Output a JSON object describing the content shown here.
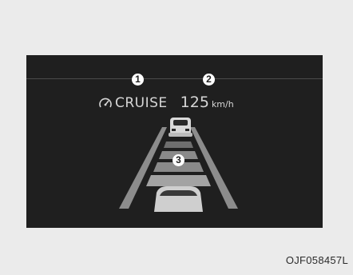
{
  "cluster": {
    "cruise_label": "CRUISE",
    "speed_value": "125",
    "speed_unit": "km/h",
    "icon": "cruise-speedometer-icon"
  },
  "callouts": [
    "1",
    "2",
    "3"
  ],
  "caption": "OJF058457L",
  "colors": {
    "background": "#ebebeb",
    "display": "#1f1f1f",
    "text": "#d6d6d6",
    "lane_marker": "#9a9a9a"
  }
}
